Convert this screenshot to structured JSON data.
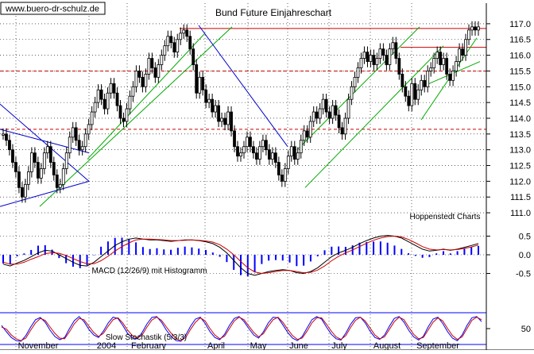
{
  "watermark": "www.buero-dr-schulz.de",
  "source_label": "Hoppenstedt Charts",
  "colors": {
    "candles": "#000000",
    "grid": "#000000",
    "resistance": "#cc0000",
    "support_dashed": "#cc0000",
    "uptrend": "#00aa00",
    "downtrend": "#0000cc",
    "macd_hist": "#0000ff",
    "macd_line": "#000000",
    "signal_line": "#cc0000",
    "stoch_k": "#0000ff",
    "stoch_d": "#cc0000",
    "stoch_band": "#0000ff"
  },
  "chart_data": [
    {
      "type": "candlestick",
      "title": "Bund Future Einjahreschart",
      "y_ticks": [
        "117.0",
        "116.5",
        "116.0",
        "115.5",
        "115.0",
        "114.5",
        "114.0",
        "113.5",
        "113.0",
        "112.5",
        "112.0",
        "111.5",
        "111.0"
      ],
      "ylim": [
        110.75,
        117.35
      ],
      "x_labels": [
        "November",
        "2004",
        "February",
        "April",
        "May",
        "June",
        "July",
        "August",
        "September"
      ],
      "horizontal_levels": [
        {
          "value": 116.85,
          "style": "solid",
          "label": "resistance"
        },
        {
          "value": 116.25,
          "style": "solid",
          "label": "resistance"
        },
        {
          "value": 115.5,
          "style": "dashed",
          "label": "support"
        },
        {
          "value": 113.65,
          "style": "dashed",
          "label": "support"
        }
      ],
      "series": [
        {
          "name": "",
          "x": [
            0,
            4,
            8,
            12,
            16,
            20,
            24,
            28,
            32,
            36,
            40,
            44,
            48,
            52,
            56,
            60,
            64,
            68,
            72,
            76,
            80,
            84,
            88,
            92,
            96,
            100,
            104,
            108,
            112,
            116,
            120,
            124,
            128,
            132,
            136,
            140,
            144,
            148,
            152,
            156,
            160,
            164,
            168,
            172,
            176,
            180,
            184,
            188,
            192,
            196,
            200,
            204,
            208,
            212,
            216,
            220,
            224,
            228,
            232,
            236,
            240,
            244,
            248,
            252,
            256,
            260,
            264,
            268,
            272,
            276,
            280,
            284,
            288,
            292,
            296,
            300,
            304,
            308,
            312,
            316,
            320,
            324,
            328,
            332,
            336,
            340,
            344,
            348,
            352,
            356,
            360,
            364,
            368,
            372,
            376,
            380,
            384,
            388,
            392,
            396,
            400,
            404,
            408,
            412,
            416,
            420,
            424,
            428,
            432,
            436,
            440,
            444,
            448,
            452,
            456,
            460,
            464,
            468,
            472,
            476,
            480,
            484,
            488,
            492,
            496,
            500,
            504,
            508,
            512,
            516,
            520,
            524,
            528,
            532,
            536,
            540,
            544,
            548,
            552,
            556,
            560,
            564,
            568,
            572,
            576,
            580,
            584,
            588,
            592,
            596,
            600
          ],
          "y": [
            113.5,
            113.3,
            113.0,
            112.6,
            112.3,
            111.8,
            111.5,
            111.9,
            112.3,
            112.9,
            112.6,
            112.1,
            112.4,
            112.9,
            113.1,
            112.6,
            112.2,
            111.8,
            111.9,
            112.4,
            112.9,
            113.4,
            113.7,
            113.3,
            113.0,
            113.1,
            113.5,
            113.8,
            114.2,
            114.5,
            114.9,
            114.6,
            114.3,
            114.8,
            115.1,
            114.8,
            114.4,
            114.0,
            113.9,
            114.3,
            114.7,
            115.0,
            115.5,
            115.3,
            115.0,
            115.4,
            115.9,
            115.6,
            115.3,
            115.7,
            116.0,
            116.3,
            116.6,
            116.4,
            116.1,
            116.5,
            116.7,
            116.8,
            116.6,
            116.2,
            115.7,
            114.8,
            115.3,
            114.9,
            114.5,
            114.6,
            114.2,
            114.4,
            113.9,
            114.0,
            113.8,
            114.2,
            113.6,
            113.1,
            112.8,
            112.9,
            113.1,
            113.4,
            113.1,
            112.9,
            112.7,
            113.1,
            113.3,
            113.0,
            112.7,
            112.9,
            112.6,
            112.2,
            112.0,
            112.4,
            112.8,
            113.1,
            112.7,
            112.9,
            113.3,
            113.6,
            113.4,
            113.9,
            114.2,
            114.0,
            114.3,
            114.6,
            114.2,
            114.0,
            114.4,
            114.1,
            113.7,
            113.5,
            114.0,
            114.6,
            115.0,
            115.3,
            115.6,
            115.9,
            116.1,
            115.8,
            116.0,
            115.7,
            115.9,
            116.2,
            116.0,
            115.7,
            116.2,
            116.4,
            115.9,
            115.4,
            115.0,
            114.7,
            114.4,
            115.1,
            114.6,
            114.9,
            115.2,
            115.0,
            115.5,
            115.6,
            115.9,
            116.1,
            115.7,
            115.9,
            115.4,
            115.2,
            115.5,
            115.8,
            116.2,
            116.0,
            116.5,
            116.8,
            116.9,
            116.8,
            116.9
          ]
        }
      ]
    },
    {
      "type": "bar+line",
      "title": "MACD (12/26/9) mit Histogramm",
      "y_ticks": [
        "0.5",
        "0.0",
        "-0.5"
      ],
      "ylim": [
        -0.8,
        0.9
      ],
      "series": [
        {
          "name": "",
          "values": [
            -0.25,
            -0.3,
            -0.22,
            -0.15,
            -0.05,
            0.05,
            0.12,
            0.1,
            0.0,
            -0.1,
            -0.2,
            -0.28,
            -0.3,
            -0.2,
            -0.05,
            0.1,
            0.25,
            0.35,
            0.42,
            0.45,
            0.42,
            0.4,
            0.4,
            0.38,
            0.36,
            0.38,
            0.4,
            0.4,
            0.38,
            0.35,
            0.3,
            0.2,
            0.05,
            -0.15,
            -0.35,
            -0.5,
            -0.55,
            -0.5,
            -0.45,
            -0.42,
            -0.4,
            -0.42,
            -0.48,
            -0.5,
            -0.45,
            -0.35,
            -0.2,
            -0.05,
            0.05,
            0.12,
            0.2,
            0.3,
            0.38,
            0.45,
            0.5,
            0.52,
            0.5,
            0.45,
            0.35,
            0.25,
            0.15,
            0.1,
            0.12,
            0.15,
            0.12,
            0.15,
            0.2,
            0.25,
            0.3
          ]
        },
        {
          "name": "",
          "values": [
            -0.2,
            -0.25,
            -0.25,
            -0.2,
            -0.12,
            -0.05,
            0.03,
            0.06,
            0.04,
            -0.02,
            -0.1,
            -0.18,
            -0.24,
            -0.24,
            -0.16,
            -0.04,
            0.1,
            0.22,
            0.32,
            0.4,
            0.42,
            0.42,
            0.41,
            0.4,
            0.38,
            0.38,
            0.39,
            0.4,
            0.39,
            0.37,
            0.34,
            0.27,
            0.15,
            0.0,
            -0.18,
            -0.35,
            -0.46,
            -0.5,
            -0.48,
            -0.45,
            -0.42,
            -0.42,
            -0.45,
            -0.48,
            -0.47,
            -0.41,
            -0.3,
            -0.16,
            -0.04,
            0.05,
            0.13,
            0.22,
            0.31,
            0.39,
            0.45,
            0.49,
            0.5,
            0.48,
            0.41,
            0.32,
            0.22,
            0.15,
            0.13,
            0.14,
            0.13,
            0.14,
            0.17,
            0.21,
            0.26
          ]
        }
      ]
    },
    {
      "type": "line",
      "title": "Slow Stochastik (5/3/3)",
      "y_ticks": [
        "50"
      ],
      "ylim": [
        0,
        100
      ],
      "bands": [
        80,
        20
      ],
      "series": [
        {
          "name": "",
          "values": [
            60,
            40,
            22,
            12,
            10,
            28,
            55,
            78,
            85,
            70,
            45,
            25,
            15,
            22,
            50,
            75,
            88,
            72,
            48,
            30,
            22,
            42,
            68,
            86,
            82,
            60,
            35,
            20,
            18,
            38,
            65,
            85,
            88,
            70,
            45,
            25,
            12,
            10,
            30,
            58,
            80,
            86,
            66,
            40,
            22,
            15,
            32,
            60,
            82,
            88,
            72,
            50,
            30,
            20,
            40,
            68,
            86,
            84,
            62,
            38,
            20,
            12,
            25,
            52,
            78,
            88,
            80,
            55,
            32,
            18,
            14,
            36,
            64,
            84,
            86,
            68,
            42,
            22,
            16,
            30,
            58,
            82,
            88,
            70,
            44,
            24,
            14,
            26,
            56,
            80,
            86,
            66,
            40,
            20,
            12,
            30,
            60,
            84,
            88,
            72
          ]
        },
        {
          "name": "",
          "values": [
            55,
            48,
            30,
            18,
            12,
            20,
            45,
            68,
            82,
            76,
            55,
            35,
            20,
            18,
            40,
            65,
            82,
            78,
            58,
            38,
            25,
            35,
            58,
            78,
            84,
            68,
            45,
            28,
            20,
            30,
            55,
            77,
            86,
            76,
            55,
            35,
            18,
            12,
            22,
            48,
            70,
            84,
            74,
            50,
            30,
            18,
            26,
            50,
            74,
            86,
            78,
            58,
            38,
            24,
            34,
            58,
            78,
            86,
            70,
            48,
            28,
            16,
            20,
            42,
            68,
            84,
            84,
            64,
            42,
            24,
            16,
            28,
            54,
            76,
            86,
            74,
            52,
            30,
            18,
            24,
            48,
            72,
            86,
            78,
            54,
            32,
            18,
            22,
            46,
            70,
            84,
            74,
            50,
            28,
            16,
            24,
            50,
            76,
            86,
            78
          ]
        }
      ]
    }
  ]
}
